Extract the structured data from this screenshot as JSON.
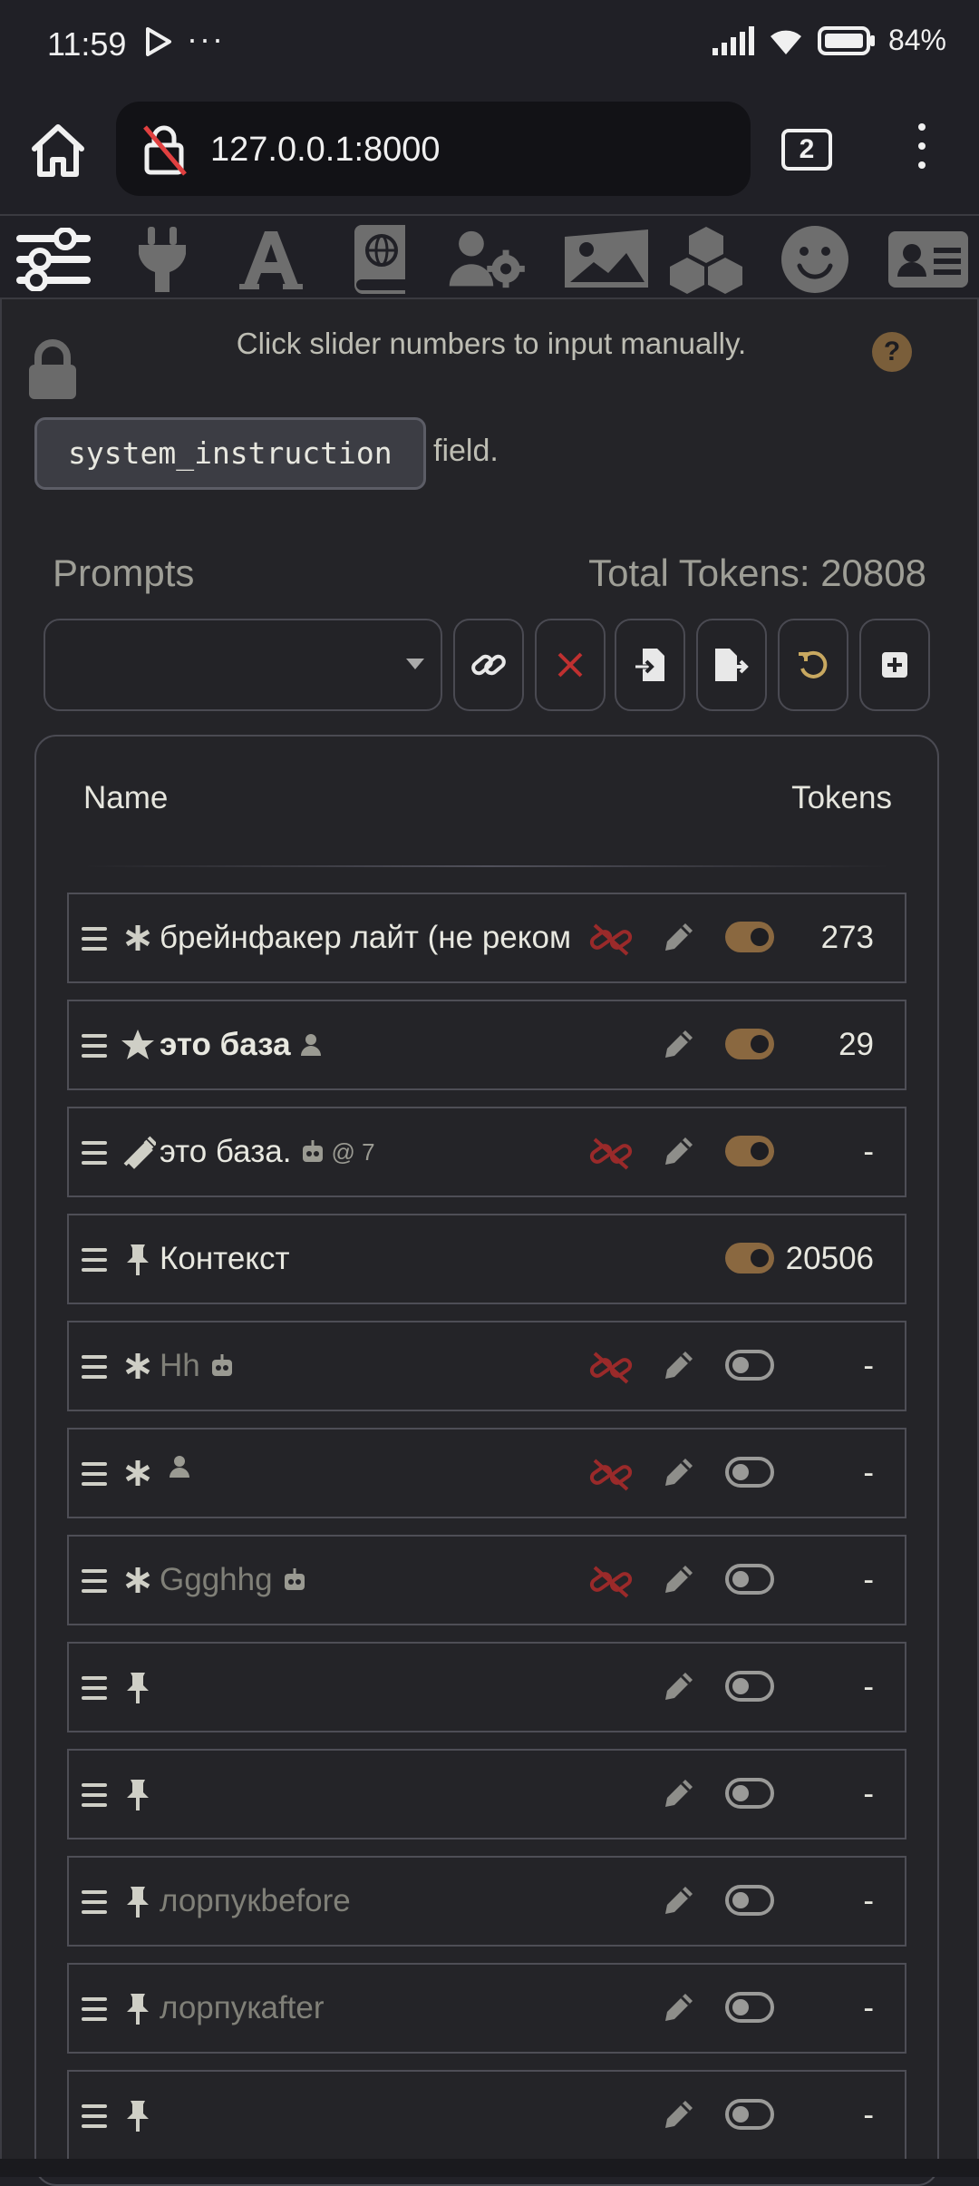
{
  "status_bar": {
    "time": "11:59",
    "more": "···",
    "battery_text": "84%"
  },
  "browser": {
    "url": "127.0.0.1:8000",
    "tab_count": "2"
  },
  "topnav": {
    "icons": [
      "sliders-icon",
      "plug-icon",
      "font-icon",
      "book-atlas-icon",
      "user-gear-icon",
      "image-icon",
      "cubes-icon",
      "smile-icon",
      "id-card-icon"
    ]
  },
  "panel": {
    "hint": "Click slider numbers to input manually.",
    "help": "?",
    "code_chip": "system_instruction",
    "field_word": "field."
  },
  "prompts": {
    "title": "Prompts",
    "total_tokens": "Total Tokens: 20808",
    "columns": {
      "name": "Name",
      "tokens": "Tokens"
    },
    "rows": [
      {
        "name": "брейнфакер лайт (не реком",
        "tokens": "273"
      },
      {
        "name": "это база",
        "tokens": "29"
      },
      {
        "name": "это база.",
        "badge": "@ 7",
        "tokens": "-"
      },
      {
        "name": "Контекст",
        "tokens": "20506"
      },
      {
        "name": "Hh",
        "tokens": "-"
      },
      {
        "name": "",
        "tokens": "-"
      },
      {
        "name": "Ggghhg",
        "tokens": "-"
      },
      {
        "name": "",
        "tokens": "-"
      },
      {
        "name": "",
        "tokens": "-"
      },
      {
        "name": "лорпукbefore",
        "tokens": "-"
      },
      {
        "name": "лорпукafter",
        "tokens": "-"
      },
      {
        "name": "",
        "tokens": "-"
      }
    ]
  },
  "colors": {
    "accent": "#8a6840",
    "unlink_red": "#9a2a2a",
    "background": "#242428"
  }
}
